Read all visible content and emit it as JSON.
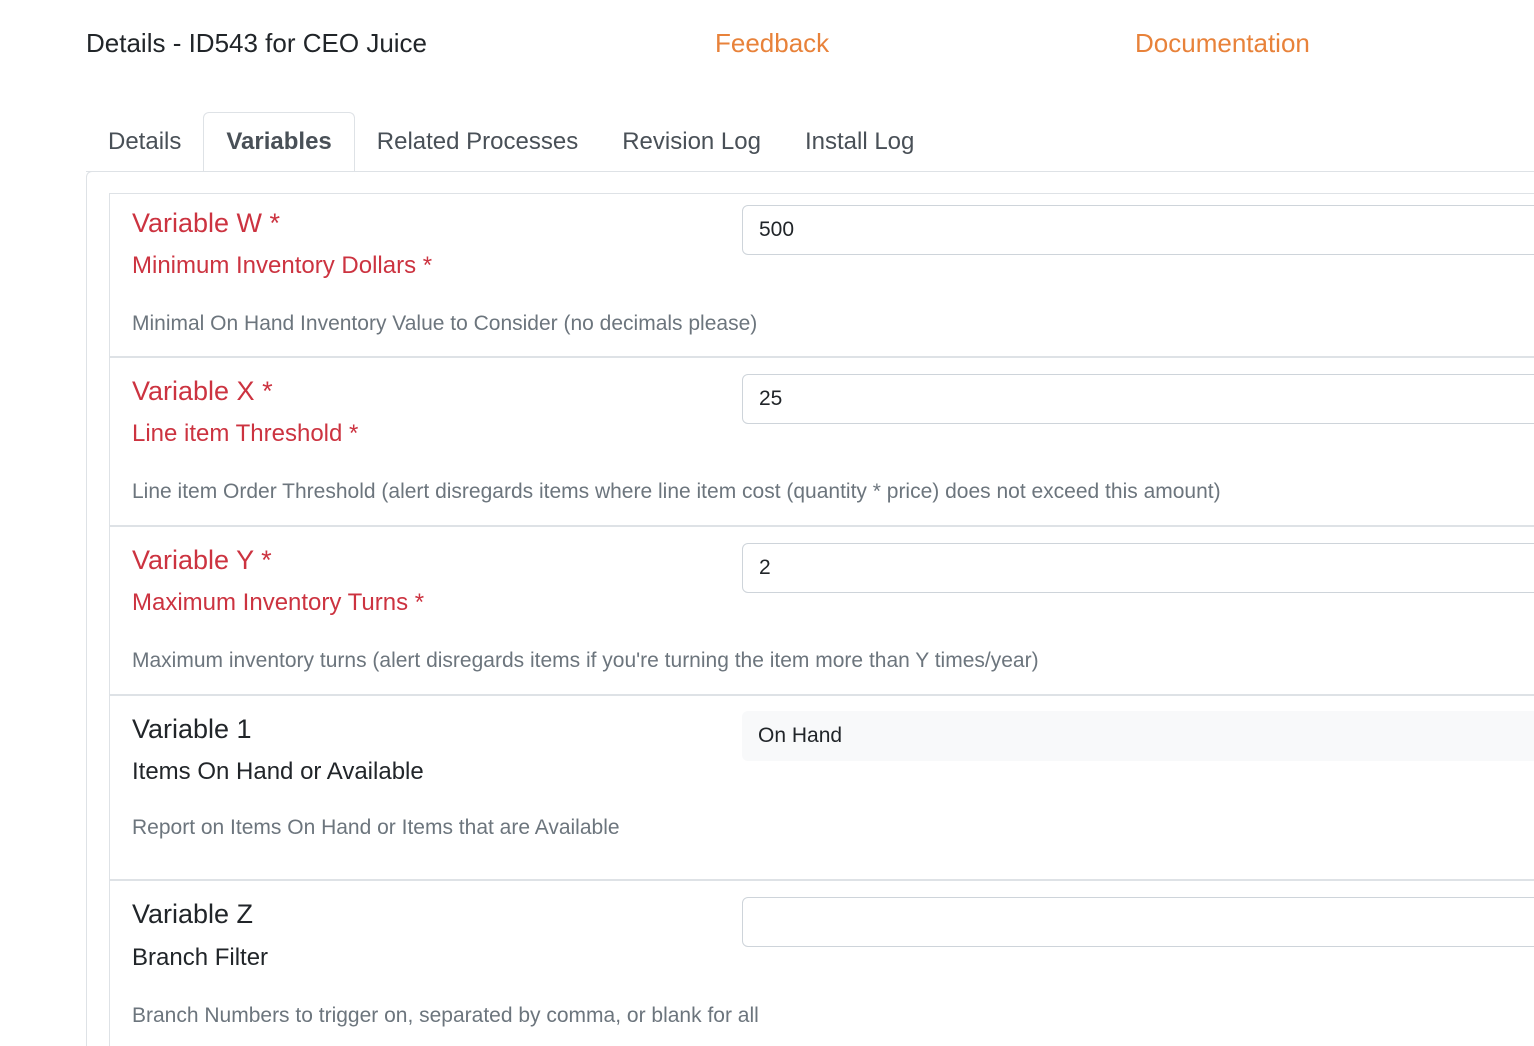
{
  "header": {
    "title": "Details - ID543 for CEO Juice",
    "feedback_label": "Feedback",
    "documentation_label": "Documentation",
    "link_color": "#e8823a"
  },
  "tabs": [
    {
      "label": "Details",
      "active": false
    },
    {
      "label": "Variables",
      "active": true
    },
    {
      "label": "Related Processes",
      "active": false
    },
    {
      "label": "Revision Log",
      "active": false
    },
    {
      "label": "Install Log",
      "active": false
    }
  ],
  "required_color": "#cc3340",
  "variables": [
    {
      "title": "Variable W *",
      "subtitle": "Minimum Inventory Dollars *",
      "description": "Minimal On Hand Inventory Value to Consider (no decimals please)",
      "value": "500",
      "required": true,
      "control": "text"
    },
    {
      "title": "Variable X *",
      "subtitle": "Line item Threshold *",
      "description": "Line item Order Threshold (alert disregards items where line item cost (quantity * price) does not exceed this amount)",
      "value": "25",
      "required": true,
      "control": "text"
    },
    {
      "title": "Variable Y *",
      "subtitle": "Maximum Inventory Turns *",
      "description": "Maximum inventory turns (alert disregards items if you're turning the item more than Y times/year)",
      "value": "2",
      "required": true,
      "control": "text"
    },
    {
      "title": "Variable 1",
      "subtitle": "Items On Hand or Available",
      "description": "Report on Items On Hand or Items that are Available",
      "value": "On Hand",
      "required": false,
      "control": "select"
    },
    {
      "title": "Variable Z",
      "subtitle": "Branch Filter",
      "description": "Branch Numbers to trigger on, separated by comma, or blank for all",
      "value": "",
      "required": false,
      "control": "text"
    }
  ]
}
